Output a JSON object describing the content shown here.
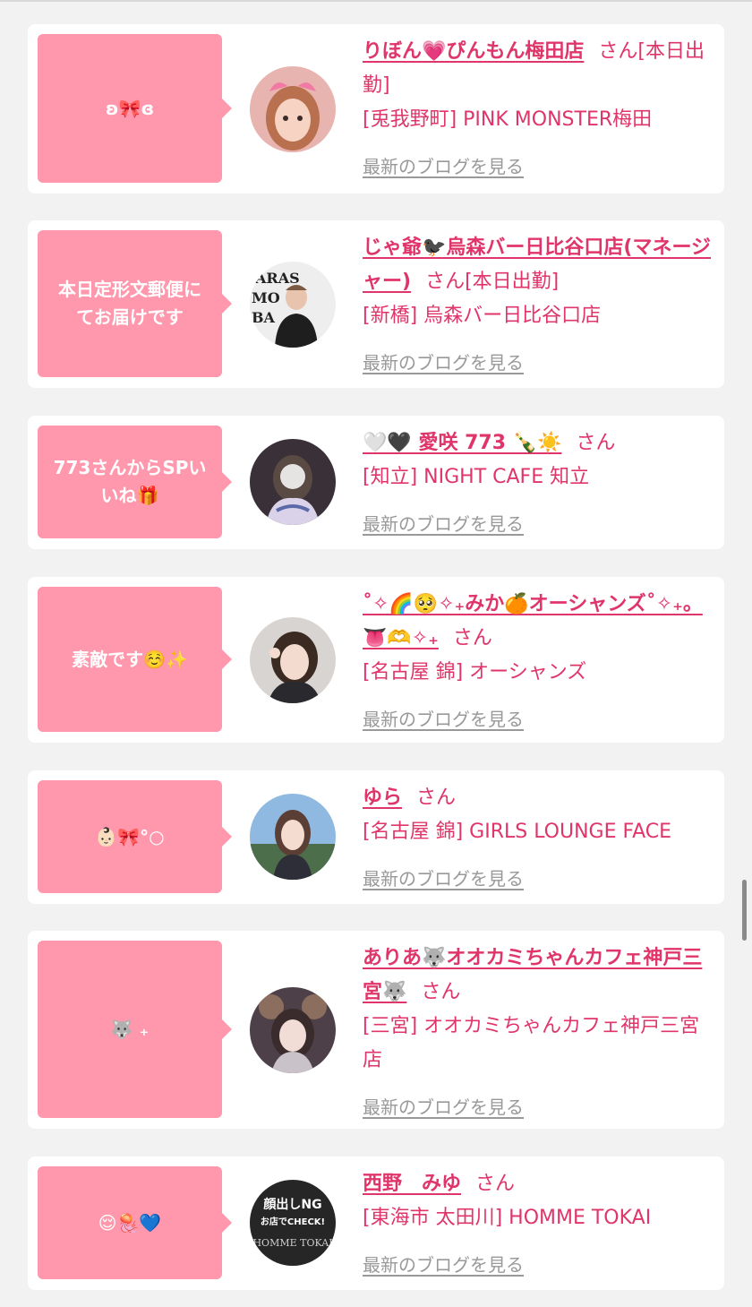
{
  "entries": [
    {
      "message": "ʚ🎀ɞ",
      "name": "りぼん💗ぴんもん梅田店",
      "honorific": "さん",
      "status": "[本日出勤]",
      "shop": "[兎我野町] PINK MONSTER梅田",
      "blog_link": "最新のブログを見る"
    },
    {
      "message": "本日定形文郵便にてお届けです",
      "name": "じゃ爺🐦‍⬛烏森バー日比谷口店(マネージャー)",
      "honorific": "さん",
      "status": "[本日出勤]",
      "shop": "[新橋] 烏森バー日比谷口店",
      "blog_link": "最新のブログを見る"
    },
    {
      "message": "773さんからSPいいね🎁",
      "name": "🤍🖤 愛咲 773 🍾☀️",
      "honorific": "さん",
      "status": "",
      "shop": "[知立] NIGHT CAFE 知立",
      "blog_link": "最新のブログを見る"
    },
    {
      "message": "素敵です☺️✨",
      "name": "˚✧🌈🥺✧₊みか🍊オーシャンズ˚✧₊。👅🫶✧₊",
      "honorific": "さん",
      "status": "",
      "shop": "[名古屋 錦] オーシャンズ",
      "blog_link": "最新のブログを見る"
    },
    {
      "message": "👶🏻🎀°○",
      "name": "ゆら",
      "honorific": "さん",
      "status": "",
      "shop": "[名古屋 錦] GIRLS LOUNGE FACE",
      "blog_link": "最新のブログを見る"
    },
    {
      "message": "🐺 ₊",
      "name": "ありあ🐺オオカミちゃんカフェ神戸三宮🐺",
      "honorific": "さん",
      "status": "",
      "shop": "[三宮] オオカミちゃんカフェ神戸三宮店",
      "blog_link": "最新のブログを見る"
    },
    {
      "message": "😌🪼💙",
      "name": "西野　みゆ",
      "honorific": "さん",
      "status": "",
      "shop": "[東海市 太田川] HOMME TOKAI",
      "blog_link": "最新のブログを見る"
    }
  ],
  "avatars": {
    "avatar_1_text": "",
    "avatar_2_text": "ARASU MO BAR",
    "avatar_7_text_1": "顔出しNG",
    "avatar_7_text_2": "お店でCHECK!",
    "avatar_7_text_3": "HOMME TOKAI"
  },
  "colors": {
    "accent": "#e0356a",
    "bubble": "#ff98ac",
    "link_gray": "#999999",
    "background": "#f2f2f2"
  }
}
